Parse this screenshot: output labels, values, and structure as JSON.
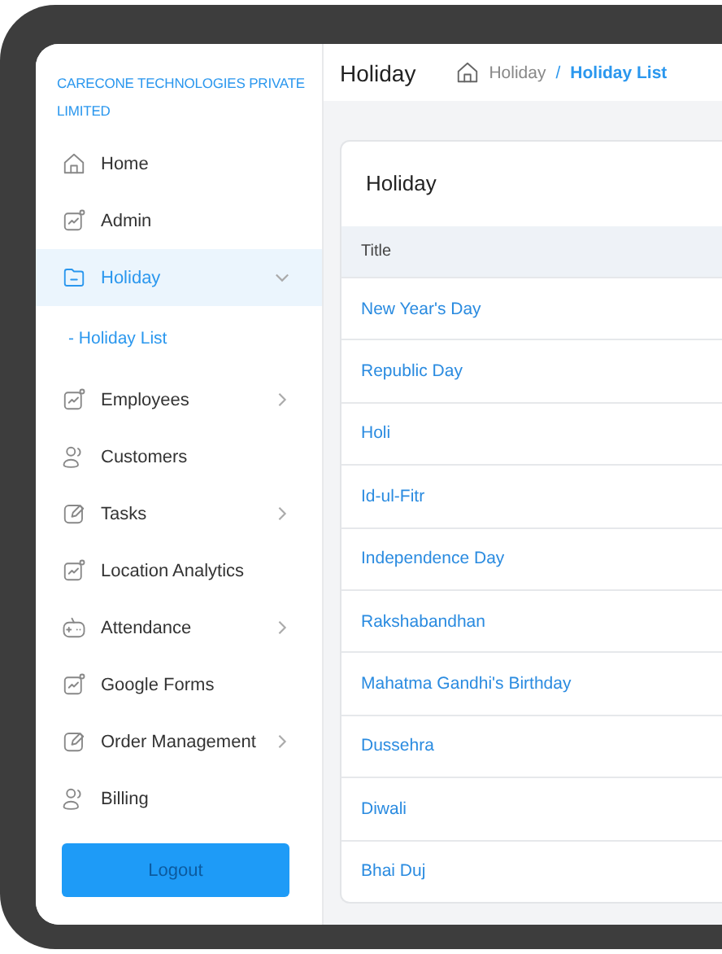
{
  "company": "CARECONE TECHNOLOGIES PRIVATE LIMITED",
  "sidebar": {
    "items": [
      {
        "label": "Home",
        "selected": false
      },
      {
        "label": "Admin",
        "selected": false
      },
      {
        "label": "Holiday",
        "selected": true,
        "expanded": true,
        "children": [
          {
            "label": "- Holiday List",
            "selected": true
          }
        ]
      },
      {
        "label": "Employees",
        "selected": false,
        "expanded": false
      },
      {
        "label": "Customers",
        "selected": false
      },
      {
        "label": "Tasks",
        "selected": false,
        "expanded": false
      },
      {
        "label": "Location Analytics",
        "selected": false
      },
      {
        "label": "Attendance",
        "selected": false,
        "expanded": false
      },
      {
        "label": "Google Forms",
        "selected": false
      },
      {
        "label": "Order Management",
        "selected": false,
        "expanded": false
      },
      {
        "label": "Billing",
        "selected": false
      }
    ],
    "logout": "Logout"
  },
  "header": {
    "title": "Holiday",
    "breadcrumb": [
      "Holiday",
      "/",
      "Holiday List"
    ]
  },
  "card": {
    "title": "Holiday",
    "table": {
      "columns": [
        "Title"
      ],
      "rows": [
        [
          "New Year's Day"
        ],
        [
          "Republic Day"
        ],
        [
          "Holi"
        ],
        [
          "Id-ul-Fitr"
        ],
        [
          "Independence Day"
        ],
        [
          "Rakshabandhan"
        ],
        [
          "Mahatma Gandhi's Birthday"
        ],
        [
          "Dussehra"
        ],
        [
          "Diwali"
        ],
        [
          "Bhai Duj"
        ]
      ]
    }
  }
}
